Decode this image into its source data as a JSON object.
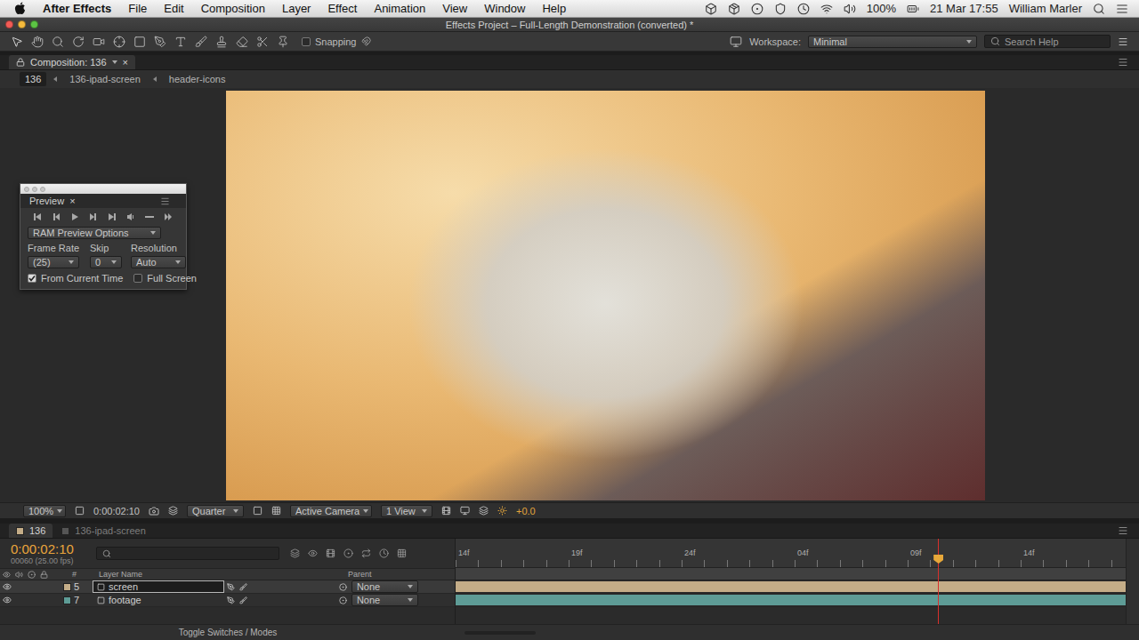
{
  "menubar": {
    "app": "After Effects",
    "menus": [
      "File",
      "Edit",
      "Composition",
      "Layer",
      "Effect",
      "Animation",
      "View",
      "Window",
      "Help"
    ],
    "battery": "100%",
    "datetime": "21 Mar  17:55",
    "user": "William Marler"
  },
  "window": {
    "title": "Effects Project – Full-Length Demonstration (converted) *"
  },
  "toolbar": {
    "snapping": {
      "label": "Snapping",
      "checked": false
    },
    "workspace_label": "Workspace:",
    "workspace": "Minimal",
    "search_placeholder": "Search Help"
  },
  "composition_panel": {
    "tab": "Composition: 136",
    "close": "×",
    "breadcrumbs": [
      {
        "label": "136",
        "selected": true
      },
      {
        "label": "136-ipad-screen",
        "selected": false
      },
      {
        "label": "header-icons",
        "selected": false
      }
    ]
  },
  "preview_panel": {
    "tab": "Preview",
    "close": "×",
    "options": "RAM Preview Options",
    "fields": [
      {
        "label": "Frame Rate",
        "value": "(25)"
      },
      {
        "label": "Skip",
        "value": "0"
      },
      {
        "label": "Resolution",
        "value": "Auto"
      }
    ],
    "checkboxes": [
      {
        "label": "From Current Time",
        "checked": true
      },
      {
        "label": "Full Screen",
        "checked": false
      }
    ]
  },
  "viewer_bar": {
    "zoom": "100%",
    "timecode": "0:00:02:10",
    "resolution": "Quarter",
    "camera": "Active Camera",
    "views": "1 View",
    "exposure": "+0.0"
  },
  "timeline": {
    "tabs": [
      {
        "label": "136",
        "selected": true
      },
      {
        "label": "136-ipad-screen",
        "selected": false
      }
    ],
    "timecode": "0:00:02:10",
    "frame_info": "00060 (25.00 fps)",
    "ruler": [
      "14f",
      "19f",
      "24f",
      "04f",
      "09f",
      "14f"
    ],
    "playhead": {
      "level": 0.72
    },
    "columns": [
      "#",
      "Layer Name",
      "Parent"
    ],
    "layers": [
      {
        "number": "5",
        "name": "screen",
        "selected": true,
        "parent": "None",
        "color": "#c4ad88"
      },
      {
        "number": "7",
        "name": "footage",
        "selected": false,
        "parent": "None",
        "color": "#5e9c96"
      }
    ],
    "footer": "Toggle Switches / Modes"
  }
}
